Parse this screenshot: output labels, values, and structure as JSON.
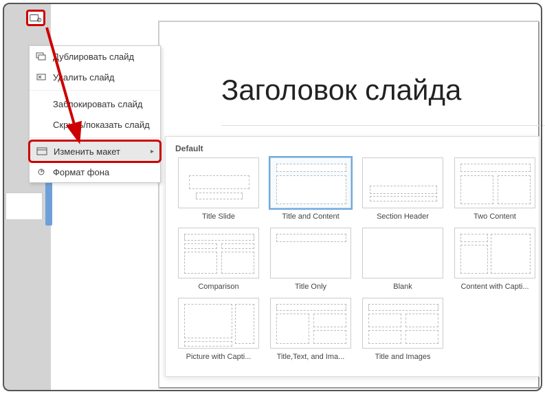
{
  "slide": {
    "title": "Заголовок слайда"
  },
  "context_menu": {
    "duplicate": "Дублировать слайд",
    "delete": "Удалить слайд",
    "lock": "Заблокировать слайд",
    "hide": "Скрыть/показать слайд",
    "change_layout": "Изменить макет",
    "background": "Формат фона"
  },
  "layout_panel": {
    "group": "Default",
    "layouts": [
      {
        "id": "title-slide",
        "label": "Title Slide"
      },
      {
        "id": "title-content",
        "label": "Title and Content",
        "selected": true
      },
      {
        "id": "section-header",
        "label": "Section Header"
      },
      {
        "id": "two-content",
        "label": "Two Content"
      },
      {
        "id": "comparison",
        "label": "Comparison"
      },
      {
        "id": "title-only",
        "label": "Title Only"
      },
      {
        "id": "blank",
        "label": "Blank"
      },
      {
        "id": "content-caption",
        "label": "Content with Capti..."
      },
      {
        "id": "picture-caption",
        "label": "Picture with Capti..."
      },
      {
        "id": "title-text-image",
        "label": "Title,Text, and Ima..."
      },
      {
        "id": "title-images",
        "label": "Title and Images"
      }
    ]
  }
}
